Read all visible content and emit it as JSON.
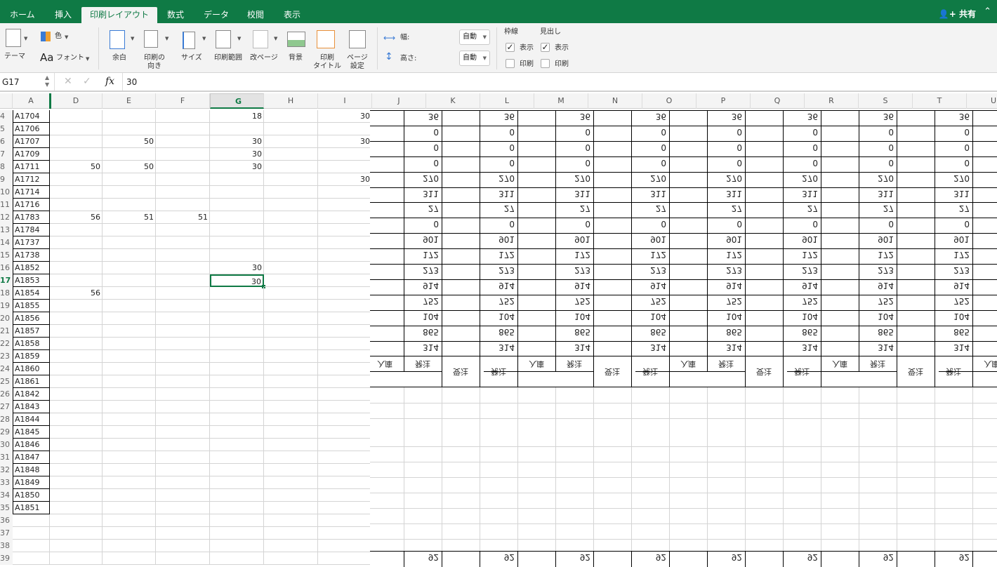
{
  "tabs": [
    "ホーム",
    "挿入",
    "印刷レイアウト",
    "数式",
    "データ",
    "校閲",
    "表示"
  ],
  "active_tab": "印刷レイアウト",
  "share_label": "共有",
  "ribbon": {
    "theme": "テーマ",
    "color": "色",
    "font": "フォント",
    "margins": "余白",
    "orientation": [
      "印刷の",
      "向き"
    ],
    "size": "サイズ",
    "print_area": "印刷範囲",
    "breaks": "改ページ",
    "background": "背景",
    "print_titles": [
      "印刷",
      "タイトル"
    ],
    "page_setup": [
      "ページ",
      "設定"
    ],
    "width_label": "幅:",
    "height_label": "高さ:",
    "width_value": "自動",
    "height_value": "自動",
    "gridlines": "枠線",
    "headings": "見出し",
    "view": "表示",
    "print": "印刷",
    "gridlines_view": true,
    "gridlines_print": false,
    "headings_view": true,
    "headings_print": false
  },
  "formula_bar": {
    "name_box": "G17",
    "fx": "fx",
    "value": "30"
  },
  "columns_left": [
    "A",
    "D",
    "E",
    "F",
    "G",
    "H",
    "I"
  ],
  "columns_right": [
    "J",
    "K",
    "L",
    "M",
    "N",
    "O",
    "P",
    "Q",
    "R",
    "S",
    "T",
    "U"
  ],
  "selected_column": "G",
  "selected_row": "17",
  "rows": [
    {
      "n": "4",
      "A": "A1704",
      "G": "18",
      "I": "30"
    },
    {
      "n": "5",
      "A": "A1706"
    },
    {
      "n": "6",
      "A": "A1707",
      "E": "50",
      "G": "30",
      "I": "30"
    },
    {
      "n": "7",
      "A": "A1709",
      "G": "30"
    },
    {
      "n": "8",
      "A": "A1711",
      "D": "50",
      "E": "50",
      "G": "30"
    },
    {
      "n": "9",
      "A": "A1712",
      "I": "30"
    },
    {
      "n": "10",
      "A": "A1714"
    },
    {
      "n": "11",
      "A": "A1716"
    },
    {
      "n": "12",
      "A": "A1783",
      "D": "56",
      "E": "51",
      "F": "51"
    },
    {
      "n": "13",
      "A": "A1784"
    },
    {
      "n": "14",
      "A": "A1737"
    },
    {
      "n": "15",
      "A": "A1738"
    },
    {
      "n": "16",
      "A": "A1852",
      "G": "30"
    },
    {
      "n": "17",
      "A": "A1853",
      "G": "30"
    },
    {
      "n": "18",
      "A": "A1854",
      "D": "56"
    },
    {
      "n": "19",
      "A": "A1855"
    },
    {
      "n": "20",
      "A": "A1856"
    },
    {
      "n": "21",
      "A": "A1857"
    },
    {
      "n": "22",
      "A": "A1858"
    },
    {
      "n": "23",
      "A": "A1859"
    },
    {
      "n": "24",
      "A": "A1860"
    },
    {
      "n": "25",
      "A": "A1861"
    },
    {
      "n": "26",
      "A": "A1842"
    },
    {
      "n": "27",
      "A": "A1843"
    },
    {
      "n": "28",
      "A": "A1844"
    },
    {
      "n": "29",
      "A": "A1845"
    },
    {
      "n": "30",
      "A": "A1846"
    },
    {
      "n": "31",
      "A": "A1847"
    },
    {
      "n": "32",
      "A": "A1848"
    },
    {
      "n": "33",
      "A": "A1849"
    },
    {
      "n": "34",
      "A": "A1850"
    },
    {
      "n": "35",
      "A": "A1851"
    },
    {
      "n": "36"
    },
    {
      "n": "37"
    },
    {
      "n": "38"
    },
    {
      "n": "39"
    }
  ],
  "overlay": {
    "values": [
      "36",
      "0",
      "0",
      "0",
      "270",
      "311",
      "27",
      "0",
      "901",
      "172",
      "273",
      "914",
      "752",
      "104",
      "865",
      "314"
    ],
    "headers": {
      "in": "入庫",
      "order": "発注",
      "received": "受注"
    },
    "bottom_value": "92"
  },
  "colors": {
    "accent": "#0f7a45"
  }
}
